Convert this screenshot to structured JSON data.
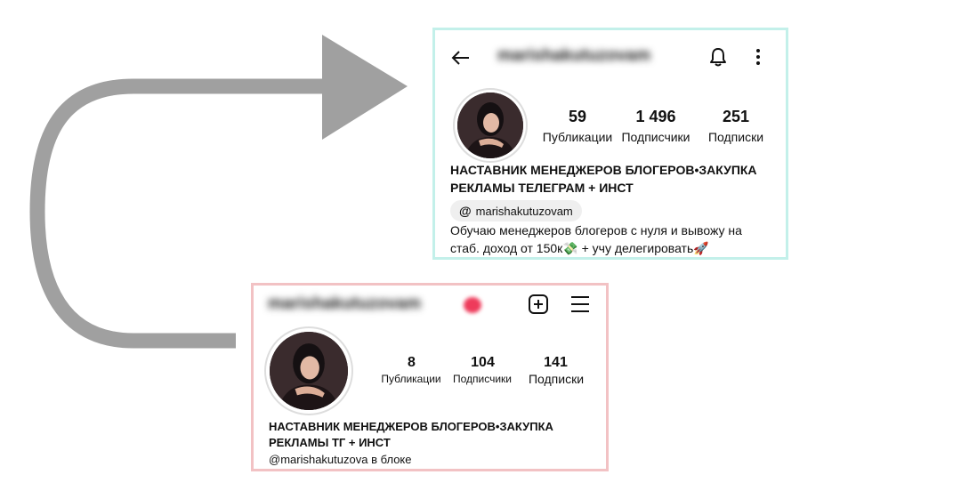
{
  "colors": {
    "arrow": "#a0a0a0",
    "top_card_border": "#c3f0ea",
    "bottom_card_border": "#f2c2c4",
    "notification_dot": "#ee3b5b"
  },
  "top_profile": {
    "username": "marishakutuzovam",
    "stats": [
      {
        "value": "59",
        "label": "Публикации"
      },
      {
        "value": "1 496",
        "label": "Подписчики"
      },
      {
        "value": "251",
        "label": "Подписки"
      }
    ],
    "bio_title_line1": "НАСТАВНИК МЕНЕДЖЕРОВ БЛОГЕРОВ•ЗАКУПКА",
    "bio_title_line2": "РЕКЛАМЫ ТЕЛЕГРАМ + ИНСТ",
    "threads_handle": "marishakutuzovam",
    "bio_text_line1": "Обучаю менеджеров блогеров с нуля и вывожу на",
    "bio_text_line2": "стаб. доход от 150к💸 + учу делегировать🚀",
    "icons": [
      "back-arrow-icon",
      "bell-icon",
      "more-vertical-icon",
      "threads-icon"
    ]
  },
  "bottom_profile": {
    "username": "marishakutuzovam",
    "stats": [
      {
        "value": "8",
        "label": "Публикации"
      },
      {
        "value": "104",
        "label": "Подписчики"
      },
      {
        "value": "141",
        "label": "Подписки"
      }
    ],
    "bio_title_line1": "НАСТАВНИК МЕНЕДЖЕРОВ БЛОГЕРОВ•ЗАКУПКА",
    "bio_title_line2": "РЕКЛАМЫ ТГ + ИНСТ",
    "bio_text": "@marishakutuzova в блоке",
    "icons": [
      "add-post-icon",
      "menu-icon"
    ]
  }
}
